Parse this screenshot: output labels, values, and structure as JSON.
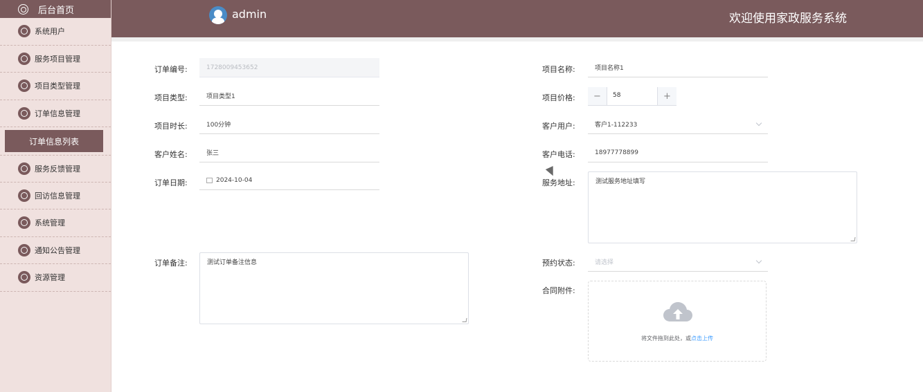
{
  "header": {
    "username": "admin",
    "title": "欢迎使用家政服务系统"
  },
  "sidebar": {
    "home": "后台首页",
    "items": [
      {
        "label": "系统用户"
      },
      {
        "label": "服务项目管理"
      },
      {
        "label": "项目类型管理"
      },
      {
        "label": "订单信息管理"
      }
    ],
    "active_sub": "订单信息列表",
    "items2": [
      {
        "label": "服务反馈管理"
      },
      {
        "label": "回访信息管理"
      },
      {
        "label": "系统管理"
      },
      {
        "label": "通知公告管理"
      },
      {
        "label": "资源管理"
      }
    ]
  },
  "form": {
    "order_no_label": "订单编号:",
    "order_no": "1728009453652",
    "project_name_label": "项目名称:",
    "project_name": "项目名称1",
    "project_type_label": "项目类型:",
    "project_type": "项目类型1",
    "price_label": "项目价格:",
    "price": "58",
    "duration_label": "项目时长:",
    "duration": "100分钟",
    "customer_user_label": "客户用户:",
    "customer_user": "客户1-112233",
    "customer_name_label": "客户姓名:",
    "customer_name": "张三",
    "phone_label": "客户电话:",
    "phone": "18977778899",
    "date_label": "订单日期:",
    "date": "2024-10-04",
    "address_label": "服务地址:",
    "address": "测试服务地址填写",
    "remark_label": "订单备注:",
    "remark": "测试订单备注信息",
    "status_label": "预约状态:",
    "status_placeholder": "请选择",
    "attachment_label": "合同附件:",
    "upload_text": "将文件拖到此处，或",
    "upload_link": "点击上传"
  }
}
